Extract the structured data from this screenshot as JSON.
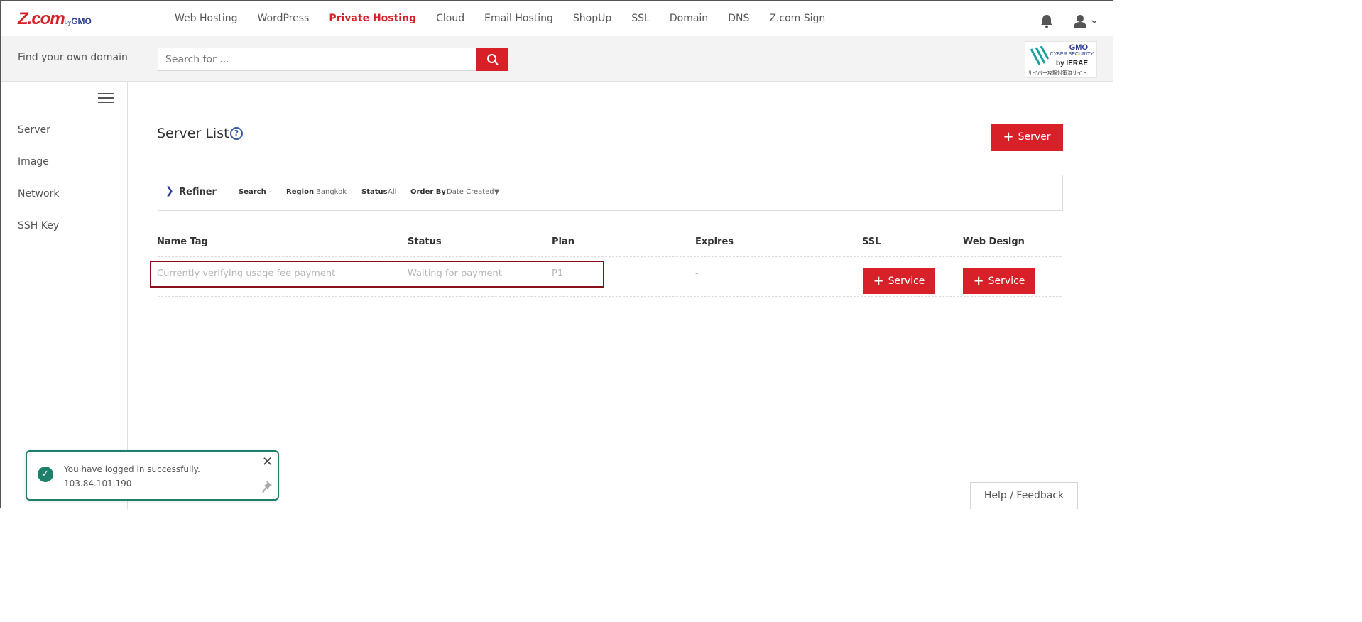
{
  "brand": {
    "logo_text": "Z.com",
    "logo_by": "by",
    "logo_gmo": "GMO"
  },
  "nav": {
    "items": [
      {
        "label": "Web Hosting",
        "active": false
      },
      {
        "label": "WordPress",
        "active": false
      },
      {
        "label": "Private Hosting",
        "active": true
      },
      {
        "label": "Cloud",
        "active": false
      },
      {
        "label": "Email Hosting",
        "active": false
      },
      {
        "label": "ShopUp",
        "active": false
      },
      {
        "label": "SSL",
        "active": false
      },
      {
        "label": "Domain",
        "active": false
      },
      {
        "label": "DNS",
        "active": false
      },
      {
        "label": "Z.com Sign",
        "active": false
      }
    ],
    "icons": [
      "bell-icon",
      "user-icon"
    ]
  },
  "domain_search": {
    "label": "Find your own domain",
    "placeholder": "Search for ...",
    "button_icon": "search-icon"
  },
  "security_badge": {
    "line1": "GMO",
    "line2": "CYBER SECURITY",
    "line3": "by IERAE",
    "line4": "サイバー攻撃対策済サイト"
  },
  "sidebar": {
    "items": [
      {
        "label": "Server"
      },
      {
        "label": "Image"
      },
      {
        "label": "Network"
      },
      {
        "label": "SSH Key"
      }
    ]
  },
  "main": {
    "title": "Server List",
    "help_icon": "?",
    "add_button": "Server",
    "refiner": {
      "title": "Refiner",
      "search_label": "Search",
      "search_value": "-",
      "region_label": "Region",
      "region_value": "Bangkok",
      "status_label": "Status",
      "status_value": "All",
      "order_label": "Order By",
      "order_value": "Date Created▼"
    },
    "table": {
      "headers": [
        "Name Tag",
        "Status",
        "Plan",
        "Expires",
        "SSL",
        "Web Design"
      ],
      "rows": [
        {
          "name_tag": "Currently verifying usage fee payment",
          "status": "Waiting for payment",
          "plan": "P1",
          "expires": "-",
          "ssl_button": "Service",
          "web_design_button": "Service"
        }
      ]
    }
  },
  "toast": {
    "message": "You have logged in successfully.",
    "ip": "103.84.101.190"
  },
  "feedback": {
    "label": "Help / Feedback"
  },
  "colors": {
    "accent": "#d72027",
    "success": "#1e7f6b",
    "brand_blue": "#2a3d8f"
  }
}
